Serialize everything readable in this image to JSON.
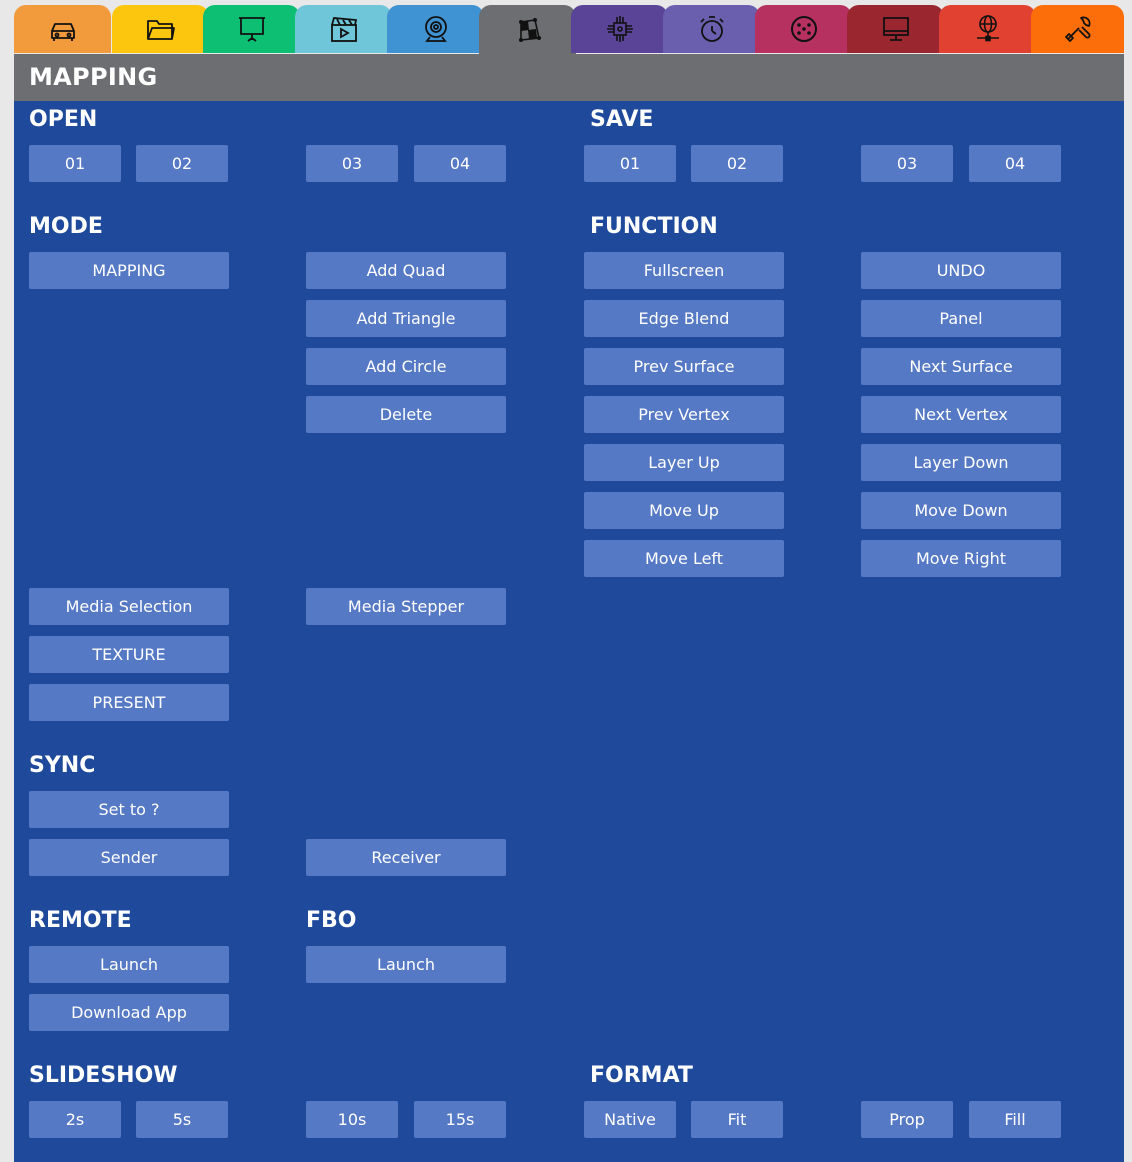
{
  "tabs": [
    {
      "icon": "car-icon",
      "color": "#f29b3d"
    },
    {
      "icon": "folder-icon",
      "color": "#fcc60f"
    },
    {
      "icon": "projector-screen-icon",
      "color": "#0cbf73"
    },
    {
      "icon": "clapperboard-icon",
      "color": "#6fc6d8"
    },
    {
      "icon": "webcam-icon",
      "color": "#3f93d3"
    },
    {
      "icon": "mapping-icon",
      "color": "#6c6e72",
      "active": true
    },
    {
      "icon": "chip-icon",
      "color": "#5a4498"
    },
    {
      "icon": "timer-icon",
      "color": "#6a5fae"
    },
    {
      "icon": "dmx-connector-icon",
      "color": "#b6315f"
    },
    {
      "icon": "monitor-icon",
      "color": "#9a2630"
    },
    {
      "icon": "network-globe-icon",
      "color": "#e14130"
    },
    {
      "icon": "tools-icon",
      "color": "#fb6e0a"
    }
  ],
  "header": {
    "title": "MAPPING"
  },
  "sections": {
    "open": "OPEN",
    "save": "SAVE",
    "mode": "MODE",
    "function": "FUNCTION",
    "sync": "SYNC",
    "remote": "REMOTE",
    "fbo": "FBO",
    "slideshow": "SLIDESHOW",
    "format": "FORMAT"
  },
  "open": [
    "01",
    "02",
    "03",
    "04"
  ],
  "save": [
    "01",
    "02",
    "03",
    "04"
  ],
  "mode": {
    "mapping": "MAPPING",
    "add_quad": "Add Quad",
    "add_triangle": "Add Triangle",
    "add_circle": "Add Circle",
    "delete": "Delete",
    "media_selection": "Media Selection",
    "media_stepper": "Media Stepper",
    "texture": "TEXTURE",
    "present": "PRESENT"
  },
  "function": {
    "fullscreen": "Fullscreen",
    "undo": "UNDO",
    "edge_blend": "Edge Blend",
    "panel": "Panel",
    "prev_surface": "Prev Surface",
    "next_surface": "Next Surface",
    "prev_vertex": "Prev Vertex",
    "next_vertex": "Next Vertex",
    "layer_up": "Layer Up",
    "layer_down": "Layer Down",
    "move_up": "Move Up",
    "move_down": "Move Down",
    "move_left": "Move Left",
    "move_right": "Move Right"
  },
  "sync": {
    "set_to": "Set to ?",
    "sender": "Sender",
    "receiver": "Receiver"
  },
  "remote": {
    "launch": "Launch",
    "download_app": "Download App"
  },
  "fbo": {
    "launch": "Launch"
  },
  "slideshow": [
    "2s",
    "5s",
    "10s",
    "15s"
  ],
  "format": [
    "Native",
    "Fit",
    "Prop",
    "Fill"
  ],
  "colors": {
    "panel": "#1f4a9c",
    "button": "#5579c4",
    "header": "#6c6e72"
  }
}
